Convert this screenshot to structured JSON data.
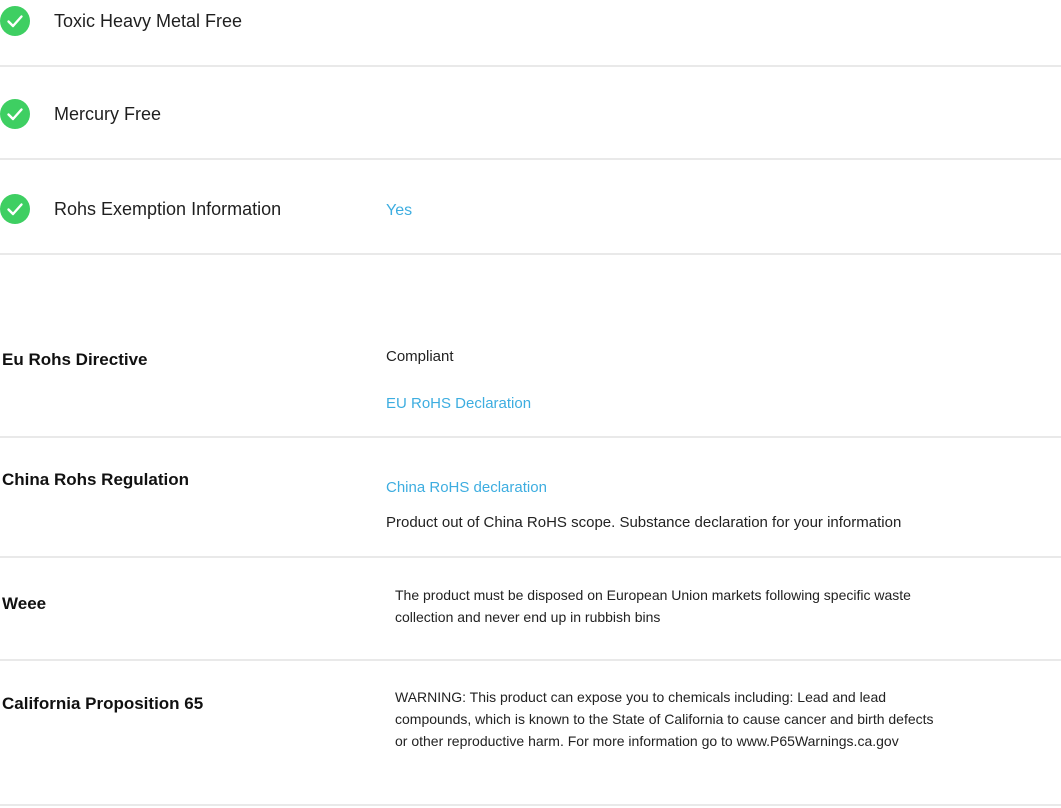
{
  "features": [
    {
      "icon": "checkmark-circle-icon",
      "label": "Toxic Heavy Metal Free",
      "value": ""
    },
    {
      "icon": "checkmark-circle-icon",
      "label": "Mercury Free",
      "value": ""
    },
    {
      "icon": "checkmark-circle-icon",
      "label": "Rohs Exemption Information",
      "value": "Yes"
    }
  ],
  "regulations": {
    "eu_rohs": {
      "label": "Eu Rohs Directive",
      "status": "Compliant",
      "link": "EU RoHS Declaration"
    },
    "china_rohs": {
      "label": "China Rohs Regulation",
      "link": "China RoHS declaration",
      "note": "Product out of China RoHS scope. Substance declaration for your information"
    },
    "weee": {
      "label": "Weee",
      "text": "The product must be disposed on European Union markets following specific waste collection and never end up in rubbish bins"
    },
    "prop65": {
      "label": "California Proposition 65",
      "text": "WARNING: This product can expose you to chemicals including: Lead and lead compounds, which is known to the State of California to cause cancer and birth defects or other reproductive harm. For more information go to www.P65Warnings.ca.gov"
    }
  },
  "colors": {
    "check_green": "#3ecf62",
    "link_blue": "#3dade0",
    "divider": "#e9e9e9"
  }
}
